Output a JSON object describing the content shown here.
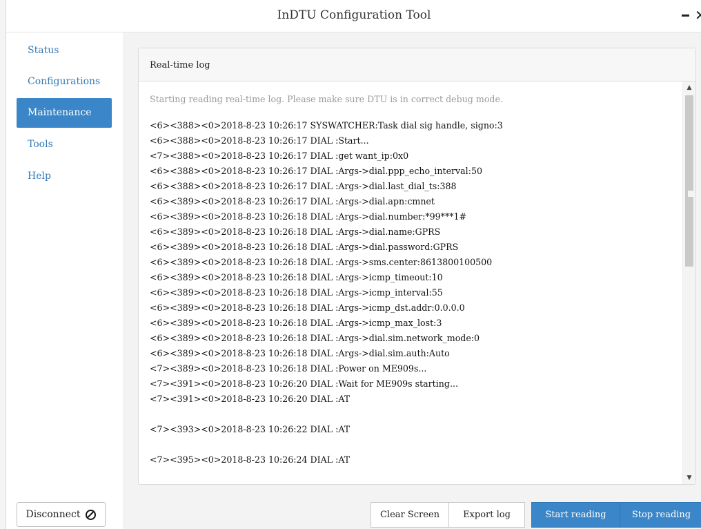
{
  "window": {
    "title": "InDTU Configuration Tool"
  },
  "sidebar": {
    "items": [
      {
        "label": "Status",
        "active": false
      },
      {
        "label": "Configurations",
        "active": false
      },
      {
        "label": "Maintenance",
        "active": true
      },
      {
        "label": "Tools",
        "active": false
      },
      {
        "label": "Help",
        "active": false
      }
    ],
    "disconnect_label": "Disconnect"
  },
  "panel": {
    "header": "Real-time log",
    "intro": "Starting reading real-time log. Please make sure DTU is in correct debug mode.",
    "lines": [
      "<6><388><0>2018-8-23 10:26:17 SYSWATCHER:Task dial sig handle, signo:3",
      "<6><388><0>2018-8-23 10:26:17 DIAL :Start...",
      "<7><388><0>2018-8-23 10:26:17 DIAL :get want_ip:0x0",
      "<6><388><0>2018-8-23 10:26:17 DIAL :Args->dial.ppp_echo_interval:50",
      "<6><388><0>2018-8-23 10:26:17 DIAL :Args->dial.last_dial_ts:388",
      "<6><389><0>2018-8-23 10:26:17 DIAL :Args->dial.apn:cmnet",
      "<6><389><0>2018-8-23 10:26:18 DIAL :Args->dial.number:*99***1#",
      "<6><389><0>2018-8-23 10:26:18 DIAL :Args->dial.name:GPRS",
      "<6><389><0>2018-8-23 10:26:18 DIAL :Args->dial.password:GPRS",
      "<6><389><0>2018-8-23 10:26:18 DIAL :Args->sms.center:8613800100500",
      "<6><389><0>2018-8-23 10:26:18 DIAL :Args->icmp_timeout:10",
      "<6><389><0>2018-8-23 10:26:18 DIAL :Args->icmp_interval:55",
      "<6><389><0>2018-8-23 10:26:18 DIAL :Args->icmp_dst.addr:0.0.0.0",
      "<6><389><0>2018-8-23 10:26:18 DIAL :Args->icmp_max_lost:3",
      "<6><389><0>2018-8-23 10:26:18 DIAL :Args->dial.sim.network_mode:0",
      "<6><389><0>2018-8-23 10:26:18 DIAL :Args->dial.sim.auth:Auto",
      "<7><389><0>2018-8-23 10:26:18 DIAL :Power on ME909s...",
      "<7><391><0>2018-8-23 10:26:20 DIAL :Wait for ME909s starting...",
      "<7><391><0>2018-8-23 10:26:20 DIAL :AT",
      "<7><393><0>2018-8-23 10:26:22 DIAL :AT",
      "<7><395><0>2018-8-23 10:26:24 DIAL :AT"
    ]
  },
  "buttons": {
    "clear_screen": "Clear Screen",
    "export_log": "Export log",
    "start_reading": "Start reading",
    "stop_reading": "Stop reading"
  },
  "colors": {
    "accent": "#3a86c8",
    "link": "#337ab7"
  }
}
